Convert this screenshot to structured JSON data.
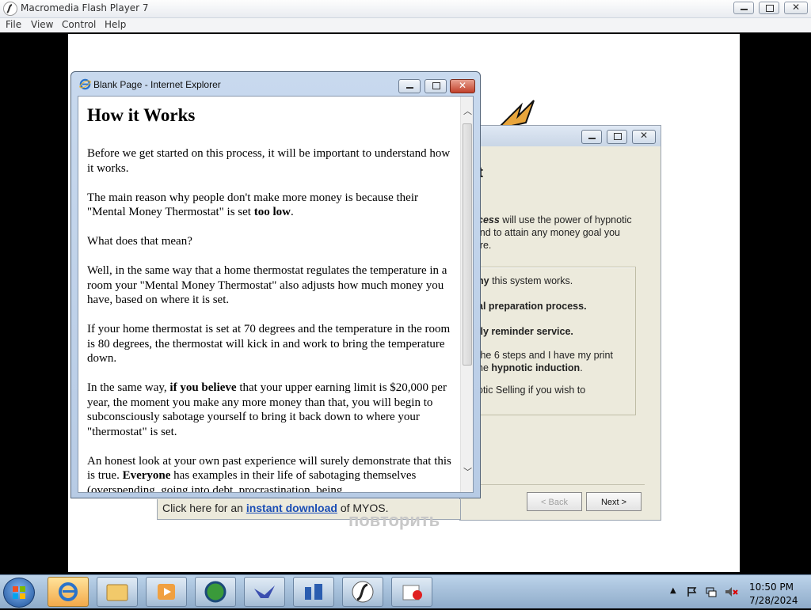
{
  "flash": {
    "title": "Macromedia Flash Player 7",
    "menu": [
      "File",
      "View",
      "Control",
      "Help"
    ]
  },
  "ie": {
    "title": "Blank Page - Internet Explorer",
    "heading": "How it Works",
    "paragraphs": [
      {
        "parts": [
          "Before we get started on this process, it will be important to understand how it works."
        ]
      },
      {
        "parts": [
          "The main reason why people don't make more money is because their \"Mental Money Thermostat\" is set ",
          {
            "b": "too low"
          },
          "."
        ]
      },
      {
        "parts": [
          "What does that mean?"
        ]
      },
      {
        "parts": [
          "Well, in the same way that a home thermostat regulates the temperature in a room your \"Mental Money Thermostat\" also adjusts how much money you have, based on where it is set."
        ]
      },
      {
        "parts": [
          "If your home thermostat is set at 70 degrees and the temperature in the room is 80 degrees, the thermostat will kick in and work to bring the temperature down."
        ]
      },
      {
        "parts": [
          "In the same way, ",
          {
            "b": "if you believe"
          },
          " that your upper earning limit is $20,000 per year, the moment you make any more money than that, you will begin to subconsciously sabotage yourself to bring it back down to where your \"thermostat\" is set."
        ]
      },
      {
        "parts": [
          "An honest look at your own past experience will surely demonstrate that this is true.  ",
          {
            "b": "Everyone"
          },
          " has examples in their life of sabotaging themselves (overspending, going into debt, procrastination, being"
        ]
      }
    ]
  },
  "movie": {
    "heading_fragment": "t",
    "intro_lines": [
      {
        "b": "cess",
        "rest": " will use the power of hypnotic"
      },
      {
        "b": "",
        "rest": "ind to attain any money goal you"
      },
      {
        "b": "",
        "rest": "ire."
      }
    ],
    "list_lines": [
      {
        "b": "hy",
        "rest": " this system works."
      },
      {
        "b": "al preparation process.",
        "rest": ""
      },
      {
        "b": "ily reminder service.",
        "rest": ""
      },
      {
        "b": "",
        "rest": "the 6 steps and I have my print"
      },
      {
        "b": "hypnotic induction",
        "rest": ".",
        "prefix": "he "
      },
      {
        "b": "",
        "rest": "otic Selling if you wish to"
      }
    ],
    "back_label": "< Back",
    "next_label": "Next >"
  },
  "download": {
    "prefix": "Click here for an ",
    "link": "instant download",
    "suffix": " of MYOS."
  },
  "replay": "повторить",
  "taskbar": {
    "apps": [
      "internet-explorer",
      "file-explorer",
      "media-player",
      "browser-globe",
      "bird-app",
      "network-app",
      "flash-player",
      "paint-app"
    ],
    "time": "10:50 PM",
    "date": "7/28/2024"
  }
}
